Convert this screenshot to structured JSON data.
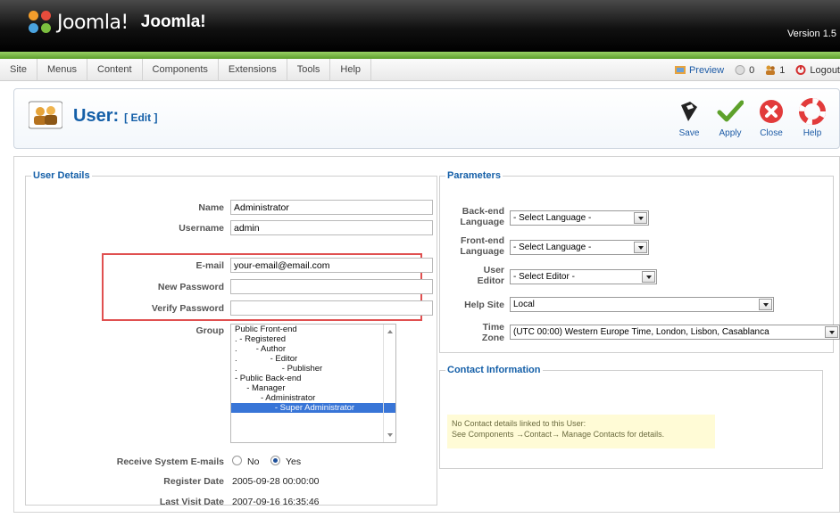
{
  "header": {
    "logo_text": "Joomla!",
    "site_name": "Joomla!",
    "version": "Version 1.5"
  },
  "menu": {
    "items": [
      "Site",
      "Menus",
      "Content",
      "Components",
      "Extensions",
      "Tools",
      "Help"
    ],
    "preview": "Preview",
    "messages_count": "0",
    "users_count": "1",
    "logout": "Logout"
  },
  "toolbar": {
    "title": "User:",
    "subtitle": "[ Edit ]",
    "buttons": [
      "Save",
      "Apply",
      "Close",
      "Help"
    ]
  },
  "user_details": {
    "legend": "User Details",
    "name_label": "Name",
    "name_value": "Administrator",
    "username_label": "Username",
    "username_value": "admin",
    "email_label": "E-mail",
    "email_value": "your-email@email.com",
    "new_password_label": "New Password",
    "verify_password_label": "Verify Password",
    "group_label": "Group",
    "groups": [
      "Public Front-end",
      ". - Registered",
      ".        - Author",
      ".              - Editor",
      ".                   - Publisher",
      "- Public Back-end",
      "     - Manager",
      "           - Administrator",
      "                 - Super Administrator"
    ],
    "receive_emails_label": "Receive System E-mails",
    "no_label": "No",
    "yes_label": "Yes",
    "register_date_label": "Register Date",
    "register_date_value": "2005-09-28 00:00:00",
    "last_visit_label": "Last Visit Date",
    "last_visit_value": "2007-09-16 16:35:46"
  },
  "parameters": {
    "legend": "Parameters",
    "backend_language_label": "Back-end Language",
    "backend_language_value": "- Select Language -",
    "frontend_language_label": "Front-end Language",
    "frontend_language_value": "- Select Language -",
    "user_editor_label": "User Editor",
    "user_editor_value": "- Select Editor -",
    "help_site_label": "Help Site",
    "help_site_value": "Local",
    "time_zone_label": "Time Zone",
    "time_zone_value": "(UTC 00:00) Western Europe Time, London, Lisbon, Casablanca"
  },
  "contact": {
    "legend": "Contact Information",
    "line1": "No Contact details linked to this User:",
    "line2": "See Components →Contact→ Manage Contacts for details."
  }
}
